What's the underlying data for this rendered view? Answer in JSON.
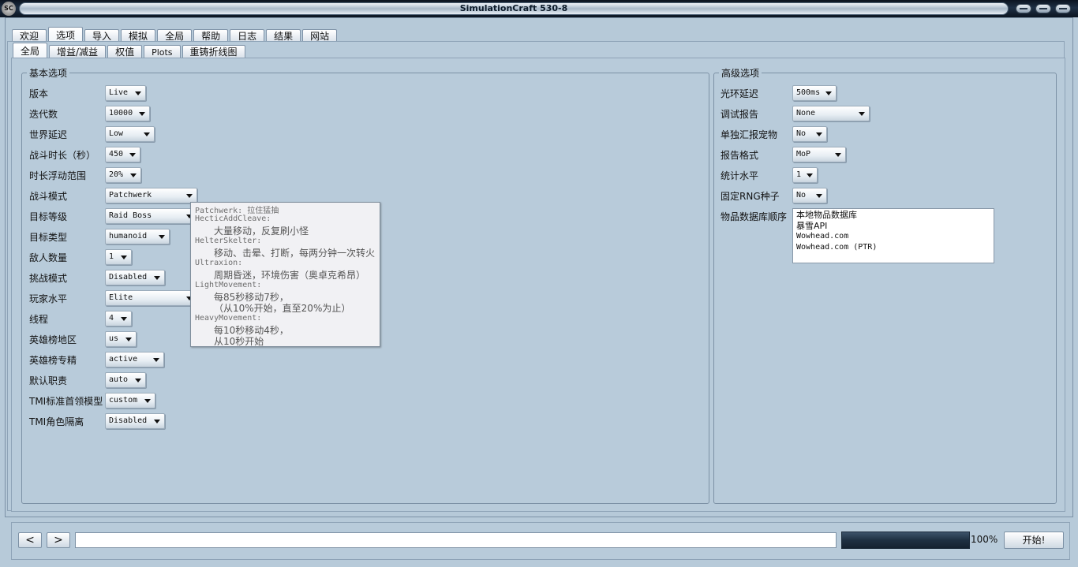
{
  "window": {
    "title": "SimulationCraft 530-8",
    "logo_text": "SC"
  },
  "main_tabs": [
    {
      "label": "欢迎"
    },
    {
      "label": "选项"
    },
    {
      "label": "导入"
    },
    {
      "label": "模拟"
    },
    {
      "label": "全局"
    },
    {
      "label": "帮助"
    },
    {
      "label": "日志"
    },
    {
      "label": "结果"
    },
    {
      "label": "网站"
    }
  ],
  "sub_tabs": [
    {
      "label": "全局"
    },
    {
      "label": "增益/减益"
    },
    {
      "label": "权值"
    },
    {
      "label": "Plots"
    },
    {
      "label": "重铸折线图"
    }
  ],
  "basic": {
    "title": "基本选项",
    "rows": [
      {
        "label": "版本",
        "value": "Live"
      },
      {
        "label": "迭代数",
        "value": "10000"
      },
      {
        "label": "世界延迟",
        "value": "Low"
      },
      {
        "label": "战斗时长（秒）",
        "value": "450"
      },
      {
        "label": "时长浮动范围",
        "value": "20%"
      },
      {
        "label": "战斗模式",
        "value": "Patchwerk"
      },
      {
        "label": "目标等级",
        "value": "Raid Boss"
      },
      {
        "label": "目标类型",
        "value": "humanoid"
      },
      {
        "label": "敌人数量",
        "value": "1"
      },
      {
        "label": "挑战模式",
        "value": "Disabled"
      },
      {
        "label": "玩家水平",
        "value": "Elite"
      },
      {
        "label": "线程",
        "value": "4"
      },
      {
        "label": "英雄榜地区",
        "value": "us"
      },
      {
        "label": "英雄榜专精",
        "value": "active"
      },
      {
        "label": "默认职责",
        "value": "auto"
      },
      {
        "label": "TMI标准首领模型",
        "value": "custom"
      },
      {
        "label": "TMI角色隔离",
        "value": "Disabled"
      }
    ]
  },
  "advanced": {
    "title": "高级选项",
    "rows": [
      {
        "label": "光环延迟",
        "value": "500ms"
      },
      {
        "label": "调试报告",
        "value": "None"
      },
      {
        "label": "单独汇报宠物",
        "value": "No"
      },
      {
        "label": "报告格式",
        "value": "MoP"
      },
      {
        "label": "统计水平",
        "value": "1"
      },
      {
        "label": "固定RNG种子",
        "value": "No"
      }
    ],
    "db_label": "物品数据库顺序",
    "db_items": [
      "本地物品数据库",
      "暴雪API",
      "Wowhead.com",
      "Wowhead.com (PTR)"
    ]
  },
  "tooltip": {
    "lines": [
      "Patchwerk: 拉住猛抽",
      "HecticAddCleave:",
      "大量移动，反复刷小怪",
      "HelterSkelter:",
      "移动、击晕、打断，每两分钟一次转火",
      "Ultraxion:",
      "周期昏迷，环境伤害（奥卓克希昂）",
      "LightMovement:",
      "每85秒移动7秒，",
      "（从10%开始，直至20%为止）",
      "HeavyMovement:",
      "每10秒移动4秒，",
      "从10秒开始"
    ]
  },
  "bottom": {
    "back_label": "<",
    "forward_label": ">",
    "progress_percent": 100,
    "progress_text": "100%",
    "start_label": "开始!"
  }
}
